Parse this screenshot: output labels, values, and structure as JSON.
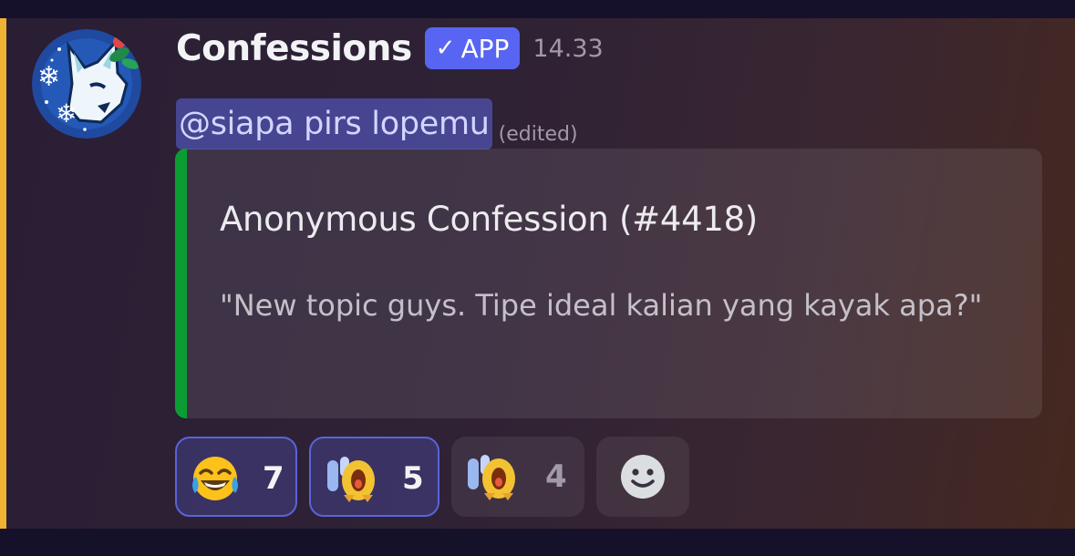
{
  "message": {
    "author": "Confessions",
    "app_tag": "APP",
    "app_tag_check": "✓",
    "timestamp": "14.33",
    "mention": "@siapa pirs lopemu",
    "edited_label": "(edited)"
  },
  "embed": {
    "title": "Anonymous Confession (#4418)",
    "description": "\"New topic guys. Tipe ideal kalian yang kayak apa?\""
  },
  "reactions": [
    {
      "emoji": "joy",
      "count": "7",
      "reacted": true
    },
    {
      "emoji": "crying-bird",
      "count": "5",
      "reacted": true
    },
    {
      "emoji": "crying-bird",
      "count": "4",
      "reacted": false
    }
  ],
  "add_reaction_icon": "smiley-add-reaction-icon",
  "colors": {
    "mention_bar": "#f0b232",
    "app_tag": "#5865f2",
    "embed_bar": "#0c9c34",
    "mention_highlight": "#5c64dc",
    "reacted_border": "#5a63d9"
  }
}
